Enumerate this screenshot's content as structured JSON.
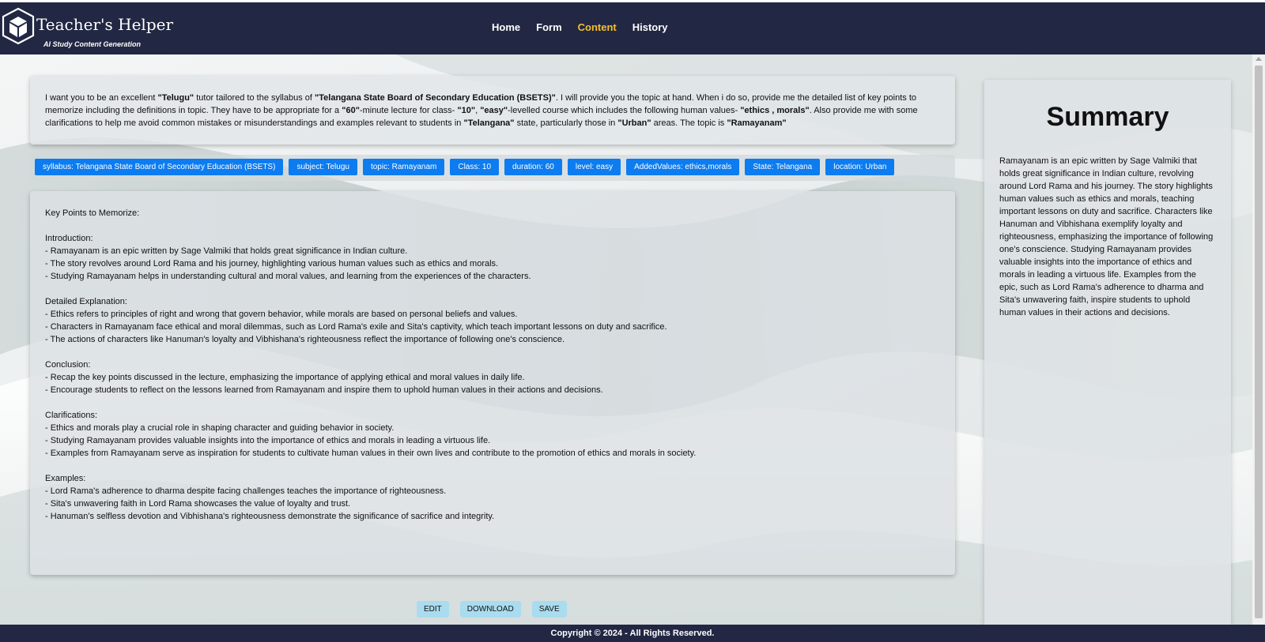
{
  "app": {
    "logo_title": "Teacher's Helper",
    "logo_subtitle": "AI Study Content Generation"
  },
  "nav": {
    "items": [
      {
        "label": "Home",
        "active": false
      },
      {
        "label": "Form",
        "active": false
      },
      {
        "label": "Content",
        "active": true
      },
      {
        "label": "History",
        "active": false
      }
    ]
  },
  "prompt": {
    "segments": [
      {
        "t": "I want you to be an excellent ",
        "b": false
      },
      {
        "t": "\"Telugu\"",
        "b": true
      },
      {
        "t": " tutor tailored to the syllabus of ",
        "b": false
      },
      {
        "t": "\"Telangana State Board of Secondary Education (BSETS)\"",
        "b": true
      },
      {
        "t": ". I will provide you the topic at hand. When i do so, provide me the detailed list of key points to memorize including the definitions in topic. They have to be appropriate for a ",
        "b": false
      },
      {
        "t": "\"60\"",
        "b": true
      },
      {
        "t": "-minute lecture for class- ",
        "b": false
      },
      {
        "t": "\"10\"",
        "b": true
      },
      {
        "t": ", ",
        "b": false
      },
      {
        "t": "\"easy\"",
        "b": true
      },
      {
        "t": "-levelled course which includes the following human values- ",
        "b": false
      },
      {
        "t": "\"ethics , morals\"",
        "b": true
      },
      {
        "t": ". Also provide me with some clarifications to help me avoid common mistakes or misunderstandings and examples relevant to students in ",
        "b": false
      },
      {
        "t": "\"Telangana\"",
        "b": true
      },
      {
        "t": " state, particularly those in ",
        "b": false
      },
      {
        "t": "\"Urban\"",
        "b": true
      },
      {
        "t": " areas. The topic is ",
        "b": false
      },
      {
        "t": "\"Ramayanam\"",
        "b": true
      }
    ]
  },
  "tags": [
    "syllabus: Telangana State Board of Secondary Education (BSETS)",
    "subject: Telugu",
    "topic: Ramayanam",
    "Class: 10",
    "duration: 60",
    "level: easy",
    "AddedValues: ethics,morals",
    "State: Telangana",
    "location: Urban"
  ],
  "content": {
    "lines": [
      "Key Points to Memorize:",
      "",
      "Introduction:",
      "- Ramayanam is an epic written by Sage Valmiki that holds great significance in Indian culture.",
      "- The story revolves around Lord Rama and his journey, highlighting various human values such as ethics and morals.",
      "- Studying Ramayanam helps in understanding cultural and moral values, and learning from the experiences of the characters.",
      "",
      "Detailed Explanation:",
      "- Ethics refers to principles of right and wrong that govern behavior, while morals are based on personal beliefs and values.",
      "- Characters in Ramayanam face ethical and moral dilemmas, such as Lord Rama's exile and Sita's captivity, which teach important lessons on duty and sacrifice.",
      "- The actions of characters like Hanuman's loyalty and Vibhishana's righteousness reflect the importance of following one's conscience.",
      "",
      "Conclusion:",
      "- Recap the key points discussed in the lecture, emphasizing the importance of applying ethical and moral values in daily life.",
      "- Encourage students to reflect on the lessons learned from Ramayanam and inspire them to uphold human values in their actions and decisions.",
      "",
      "Clarifications:",
      "- Ethics and morals play a crucial role in shaping character and guiding behavior in society.",
      "- Studying Ramayanam provides valuable insights into the importance of ethics and morals in leading a virtuous life.",
      "- Examples from Ramayanam serve as inspiration for students to cultivate human values in their own lives and contribute to the promotion of ethics and morals in society.",
      "",
      "Examples:",
      "- Lord Rama's adherence to dharma despite facing challenges teaches the importance of righteousness.",
      "- Sita's unwavering faith in Lord Rama showcases the value of loyalty and trust.",
      "- Hanuman's selfless devotion and Vibhishana's righteousness demonstrate the significance of sacrifice and integrity."
    ]
  },
  "summary": {
    "title": "Summary",
    "text": "Ramayanam is an epic written by Sage Valmiki that holds great significance in Indian culture, revolving around Lord Rama and his journey. The story highlights human values such as ethics and morals, teaching important lessons on duty and sacrifice. Characters like Hanuman and Vibhishana exemplify loyalty and righteousness, emphasizing the importance of following one's conscience. Studying Ramayanam provides valuable insights into the importance of ethics and morals in leading a virtuous life. Examples from the epic, such as Lord Rama's adherence to dharma and Sita's unwavering faith, inspire students to uphold human values in their actions and decisions."
  },
  "actions": {
    "edit_label": "EDIT",
    "download_label": "DOWNLOAD",
    "save_label": "SAVE"
  },
  "footer": {
    "text": "Copyright © 2024 - All Rights Reserved."
  },
  "colors": {
    "navbar": "#222743",
    "nav_active": "#f2c02c",
    "tag": "#0d7cf0",
    "action_button": "#a9dcee"
  }
}
